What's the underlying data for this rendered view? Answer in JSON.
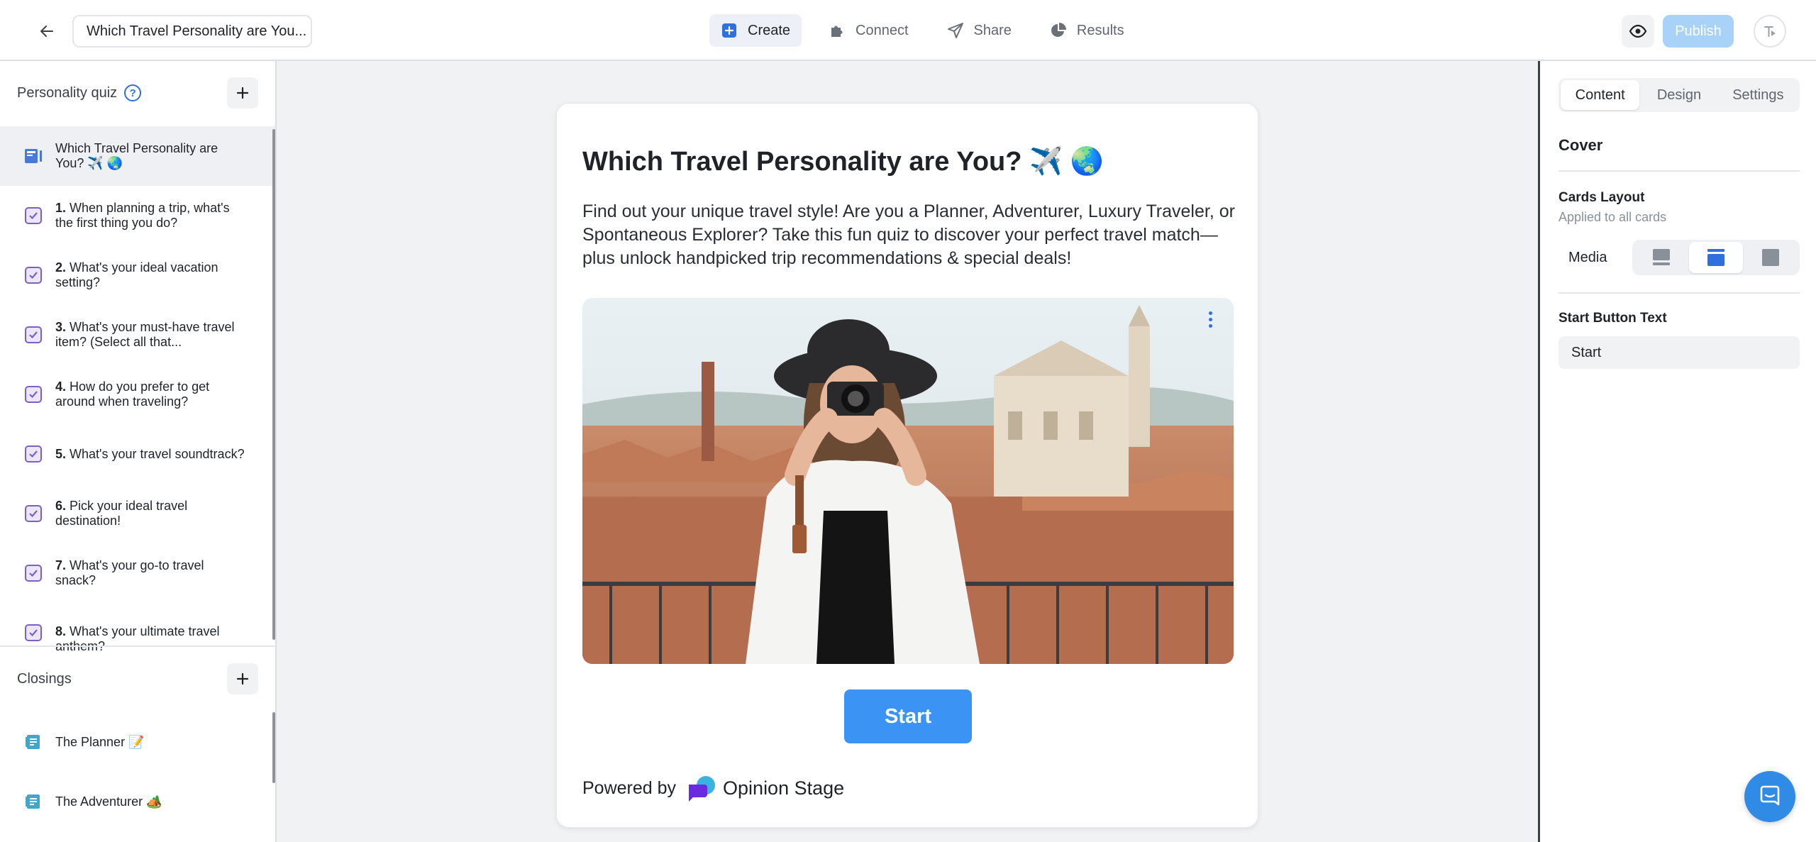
{
  "header": {
    "quiz_title": "Which Travel Personality are You...",
    "tabs": [
      {
        "label": "Create",
        "icon": "plus-square-icon",
        "active": true
      },
      {
        "label": "Connect",
        "icon": "puzzle-icon",
        "active": false
      },
      {
        "label": "Share",
        "icon": "paper-plane-icon",
        "active": false
      },
      {
        "label": "Results",
        "icon": "pie-chart-icon",
        "active": false
      }
    ],
    "publish_label": "Publish"
  },
  "sidebar": {
    "section_title": "Personality quiz",
    "cover_item": {
      "label": "Which Travel Personality are You? ✈️ 🌏"
    },
    "questions": [
      {
        "num": "1.",
        "text": "When planning a trip, what's the first thing you do?"
      },
      {
        "num": "2.",
        "text": "What's your ideal vacation setting?"
      },
      {
        "num": "3.",
        "text": "What's your must-have travel item? (Select all that..."
      },
      {
        "num": "4.",
        "text": "How do you prefer to get around when traveling?"
      },
      {
        "num": "5.",
        "text": "What's your travel soundtrack?"
      },
      {
        "num": "6.",
        "text": "Pick your ideal travel destination!"
      },
      {
        "num": "7.",
        "text": "What's your go-to travel snack?"
      },
      {
        "num": "8.",
        "text": "What's your ultimate travel anthem?"
      }
    ],
    "closings_title": "Closings",
    "closings": [
      {
        "label": "The Planner 📝"
      },
      {
        "label": "The Adventurer 🏕️"
      }
    ]
  },
  "card": {
    "title": "Which Travel Personality are You? ✈️ 🌏",
    "description": "Find out your unique travel style! Are you a Planner, Adventurer, Luxury Traveler, or Spontaneous Explorer? Take this fun quiz to discover your perfect travel match—plus unlock handpicked trip recommendations & special deals!",
    "start_label": "Start",
    "powered_by": "Powered by",
    "brand": "Opinion Stage"
  },
  "right_panel": {
    "tabs": [
      {
        "label": "Content",
        "active": true
      },
      {
        "label": "Design",
        "active": false
      },
      {
        "label": "Settings",
        "active": false
      }
    ],
    "section_title": "Cover",
    "cards_layout_label": "Cards Layout",
    "cards_layout_sub": "Applied to all cards",
    "media_label": "Media",
    "start_button_text_label": "Start Button Text",
    "start_button_text_value": "Start"
  },
  "colors": {
    "accent": "#3b94f3",
    "publish_disabled": "#a9d2f8",
    "check_purple": "#7b61c4"
  }
}
